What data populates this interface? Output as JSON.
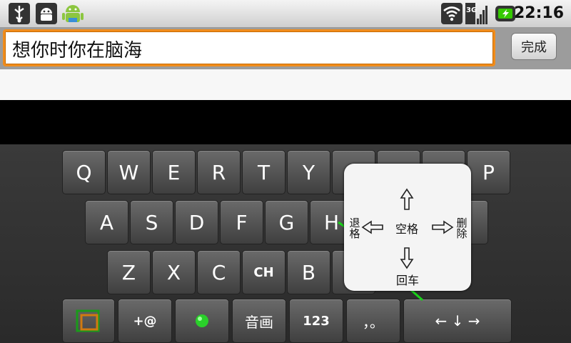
{
  "status_bar": {
    "time": "22:16",
    "network_label": "3G"
  },
  "editor": {
    "text": "想你时你在脑海",
    "done_label": "完成"
  },
  "keyboard": {
    "row1": [
      "Q",
      "W",
      "E",
      "R",
      "T",
      "Y",
      "",
      "",
      "",
      "P"
    ],
    "row2": [
      "A",
      "S",
      "D",
      "F",
      "G",
      "H"
    ],
    "row3": [
      "Z",
      "X",
      "C",
      "CH",
      "B"
    ],
    "bottom": {
      "symbols": "+@",
      "sound": "音画",
      "numbers": "123",
      "punct": "，。",
      "arrows": "← ↓ →"
    }
  },
  "gesture_popup": {
    "center": "空格",
    "left": "退格",
    "right": "删除",
    "bottom": "回车"
  },
  "colors": {
    "focus_border": "#f08c1c",
    "battery_accent": "#35c900",
    "swipe_trail": "#19d219"
  }
}
